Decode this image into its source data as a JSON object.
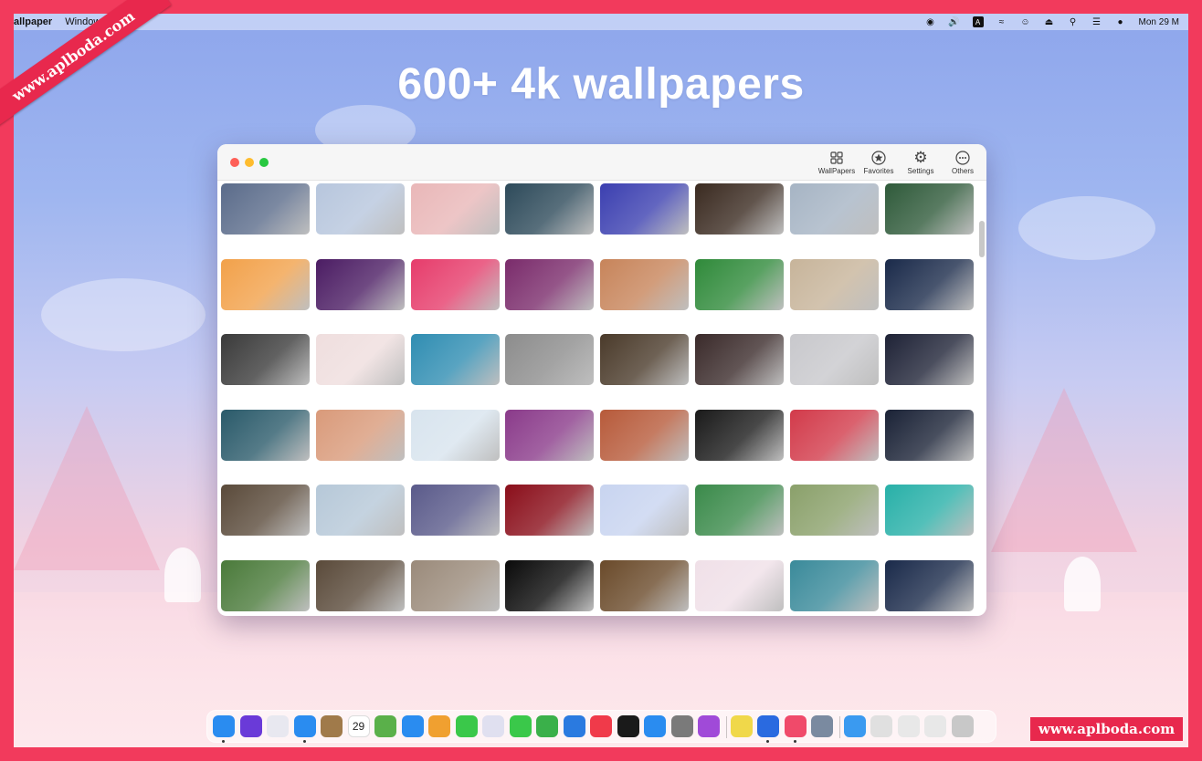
{
  "menubar": {
    "app_name": "allpaper",
    "menu_window": "Window",
    "clock": "Mon 29 M",
    "icons": [
      "screen-record-icon",
      "volume-icon",
      "keyboard-input-icon",
      "wifi-icon",
      "user-icon",
      "eject-icon",
      "search-icon",
      "control-center-icon",
      "siri-icon"
    ]
  },
  "ribbon_text": "www.aplboda.com",
  "headline": "600+ 4k wallpapers",
  "window": {
    "toolbar": [
      {
        "label": "WallPapers",
        "icon": "grid-icon"
      },
      {
        "label": "Favorites",
        "icon": "star-circle-icon"
      },
      {
        "label": "Settings",
        "icon": "gear-icon"
      },
      {
        "label": "Others",
        "icon": "ellipsis-circle-icon"
      }
    ],
    "thumbnails": [
      [
        "#5a6b8a",
        "#b7c6dd",
        "#e9b7b8",
        "#2d4a5a",
        "#3b3fb0",
        "#3a2a20",
        "#a6b4c4",
        "#2f5a3a"
      ],
      [
        "#f2a14a",
        "#4b1c63",
        "#e63c6b",
        "#7a2b6b",
        "#c7845a",
        "#2f8a3a",
        "#c7b49a",
        "#1a2a4a"
      ],
      [
        "#3a3a3a",
        "#efdede",
        "#2f8db2",
        "#8c8c8c",
        "#4a3a2a",
        "#3a2a2a",
        "#c8c8cc",
        "#1e2236"
      ],
      [
        "#2a5a6a",
        "#d99a7a",
        "#d8e4ee",
        "#8a3a8a",
        "#b75a3a",
        "#1a1a1a",
        "#d23a4a",
        "#1a2236"
      ],
      [
        "#5a4a3a",
        "#b6c8d8",
        "#5a5a8a",
        "#8a0e1a",
        "#c8d4f0",
        "#3a8a4a",
        "#8aa06a",
        "#28b0a8"
      ],
      [
        "#4a7a3a",
        "#5a4a3a",
        "#9a8a7a",
        "#0a0a0a",
        "#6a4a2a",
        "#f0e0e8",
        "#3a8a9a",
        "#1a2a4a"
      ]
    ]
  },
  "dock": {
    "apps": [
      "finder-icon",
      "siri-icon",
      "launchpad-icon",
      "safari-icon",
      "notes-brown-icon",
      "calendar-icon",
      "maps-icon",
      "mail-icon",
      "photos-icon",
      "messages-icon",
      "preview-icon",
      "facetime-icon",
      "numbers-icon",
      "keynote-icon",
      "music-icon",
      "appletv-icon",
      "appstore-icon",
      "system-preferences-icon",
      "podcasts-icon",
      "notes-icon",
      "xcode-icon",
      "wallpaper-app-icon",
      "printer-icon",
      "folder-icon",
      "screenshot-icon",
      "window-icon",
      "window-icon-2",
      "trash-icon"
    ],
    "calendar_day": "29"
  },
  "watermark": "www.aplboda.com"
}
